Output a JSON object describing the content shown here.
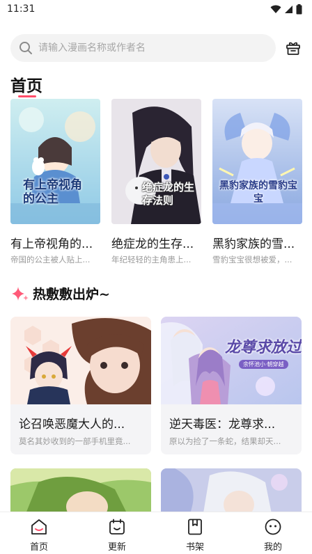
{
  "status_bar": {
    "time": "11:31"
  },
  "search": {
    "placeholder": "请输入漫画名称或作者名"
  },
  "page": {
    "title": "首页"
  },
  "recommended": [
    {
      "title": "有上帝视角的...",
      "desc": "帝国的公主被人贴上...",
      "cover_text": "有上帝视角的公主"
    },
    {
      "title": "绝症龙的生存...",
      "desc": "年纪轻轻的主角患上...",
      "cover_text": "绝症龙的生存法则"
    },
    {
      "title": "黑豹家族的雪...",
      "desc": "雪豹宝宝很想被爱，...",
      "cover_text": "黑豹家族的雪豹宝宝"
    }
  ],
  "hot_section": {
    "title": "热敷敷出炉~"
  },
  "hot_items": [
    {
      "title": "论召唤恶魔大人的...",
      "desc": "莫名其妙收到的一部手机里竟..."
    },
    {
      "title": "逆天毒医：龙尊求...",
      "desc": "原以为捡了一条蛇，结果却天...",
      "cover_text": "龙尊求放过",
      "cover_sub": "余怀池小·朝穿越"
    }
  ],
  "bottom_nav": [
    {
      "label": "首页",
      "icon": "home-icon"
    },
    {
      "label": "更新",
      "icon": "calendar-icon"
    },
    {
      "label": "书架",
      "icon": "bookshelf-icon"
    },
    {
      "label": "我的",
      "icon": "profile-icon"
    }
  ],
  "colors": {
    "accent": "#ff4d6a",
    "search_bg": "#f3f3f3",
    "card_bg": "#f4f4f6"
  }
}
